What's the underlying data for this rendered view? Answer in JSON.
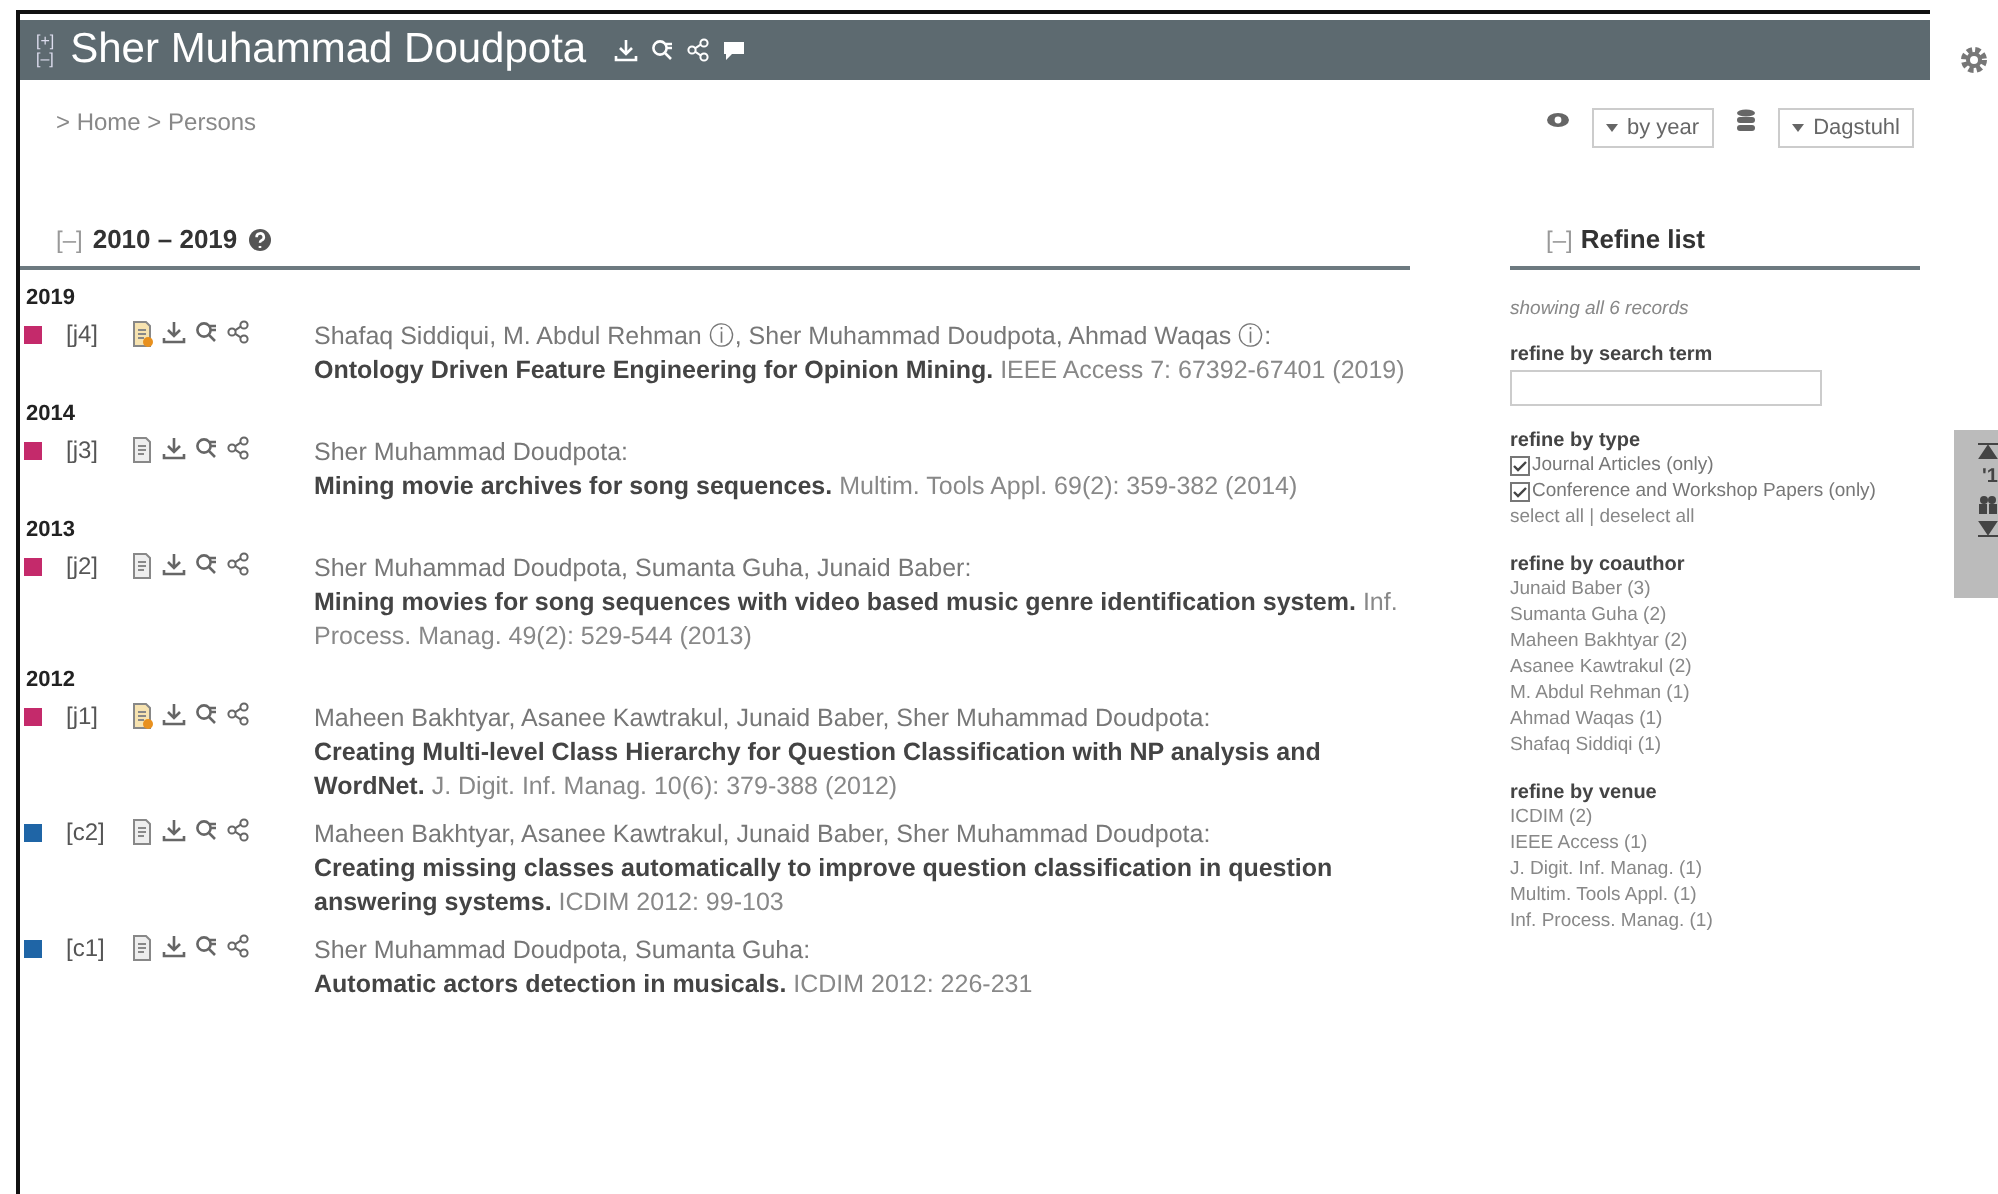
{
  "header": {
    "toggle_open": "[+]",
    "toggle_close": "[–]",
    "title": "Sher Muhammad Doudpota"
  },
  "breadcrumb": "> Home > Persons",
  "view_controls": [
    {
      "kind": "view",
      "label": "by year"
    },
    {
      "kind": "database",
      "label": "Dagstuhl"
    }
  ],
  "section": {
    "toggle": "[–]",
    "title": "2010 – 2019"
  },
  "groups": [
    {
      "year": "2019",
      "entries": [
        {
          "key": "[j4]",
          "color": "#c42a6b",
          "open_access": true,
          "authors": "Shafaq Siddiqui, M. Abdul Rehman ⓘ, Sher Muhammad Doudpota, Ahmad Waqas ⓘ:",
          "title": "Ontology Driven Feature Engineering for Opinion Mining.",
          "venue": "IEEE Access 7: 67392-67401 (2019)"
        }
      ]
    },
    {
      "year": "2014",
      "entries": [
        {
          "key": "[j3]",
          "color": "#c42a6b",
          "open_access": false,
          "authors": "Sher Muhammad Doudpota:",
          "title": "Mining movie archives for song sequences.",
          "venue": "Multim. Tools Appl. 69(2): 359-382 (2014)"
        }
      ]
    },
    {
      "year": "2013",
      "entries": [
        {
          "key": "[j2]",
          "color": "#c42a6b",
          "open_access": false,
          "authors": "Sher Muhammad Doudpota, Sumanta Guha, Junaid Baber:",
          "title": "Mining movies for song sequences with video based music genre identification system.",
          "venue": "Inf. Process. Manag. 49(2): 529-544 (2013)"
        }
      ]
    },
    {
      "year": "2012",
      "entries": [
        {
          "key": "[j1]",
          "color": "#c42a6b",
          "open_access": true,
          "authors": "Maheen Bakhtyar, Asanee Kawtrakul, Junaid Baber, Sher Muhammad Doudpota:",
          "title": "Creating Multi-level Class Hierarchy for Question Classification with NP analysis and WordNet.",
          "venue": "J. Digit. Inf. Manag. 10(6): 379-388 (2012)"
        },
        {
          "key": "[c2]",
          "color": "#1f65a6",
          "open_access": false,
          "authors": "Maheen Bakhtyar, Asanee Kawtrakul, Junaid Baber, Sher Muhammad Doudpota:",
          "title": "Creating missing classes automatically to improve question classification in question answering systems.",
          "venue": "ICDIM 2012: 99-103"
        },
        {
          "key": "[c1]",
          "color": "#1f65a6",
          "open_access": false,
          "authors": "Sher Muhammad Doudpota, Sumanta Guha:",
          "title": "Automatic actors detection in musicals.",
          "venue": "ICDIM 2012: 226-231"
        }
      ]
    }
  ],
  "refine": {
    "toggle": "[–]",
    "title": "Refine list",
    "summary": "showing all 6 records",
    "search": {
      "heading": "refine by search term"
    },
    "type": {
      "heading": "refine by type",
      "items": [
        {
          "label": "Journal Articles",
          "only": "(only)",
          "checked": true
        },
        {
          "label": "Conference and Workshop Papers",
          "only": "(only)",
          "checked": true
        }
      ],
      "select_all": "select all",
      "separator": "|",
      "deselect_all": "deselect all"
    },
    "coauthor": {
      "heading": "refine by coauthor",
      "items": [
        "Junaid Baber (3)",
        "Sumanta Guha (2)",
        "Maheen Bakhtyar (2)",
        "Asanee Kawtrakul (2)",
        "M. Abdul Rehman (1)",
        "Ahmad Waqas (1)",
        "Shafaq Siddiqi (1)"
      ]
    },
    "venue": {
      "heading": "refine by venue",
      "items": [
        "ICDIM (2)",
        "IEEE Access (1)",
        "J. Digit. Inf. Manag. (1)",
        "Multim. Tools Appl. (1)",
        "Inf. Process. Manag. (1)"
      ]
    }
  },
  "side_nav": {
    "decade": "'1"
  }
}
